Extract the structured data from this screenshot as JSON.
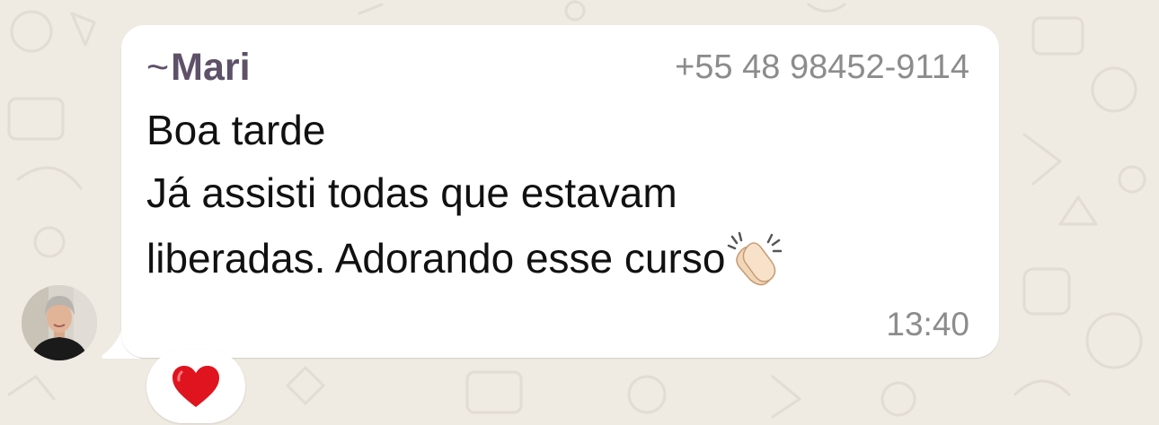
{
  "message": {
    "sender_prefix": "~",
    "sender_name": "Mari",
    "sender_phone": "+55 48 98452-9114",
    "lines": [
      "Boa tarde",
      "Já assisti todas que estavam",
      "liberadas. Adorando esse curso"
    ],
    "trailing_emoji": "clapping-hands-icon",
    "time": "13:40"
  },
  "reaction": {
    "emoji": "heart-icon"
  },
  "colors": {
    "chat_background": "#efeae2",
    "bubble": "#ffffff",
    "sender_name": "#5e5168",
    "meta_text": "#8c8c8c",
    "heart": "#e0141e"
  }
}
